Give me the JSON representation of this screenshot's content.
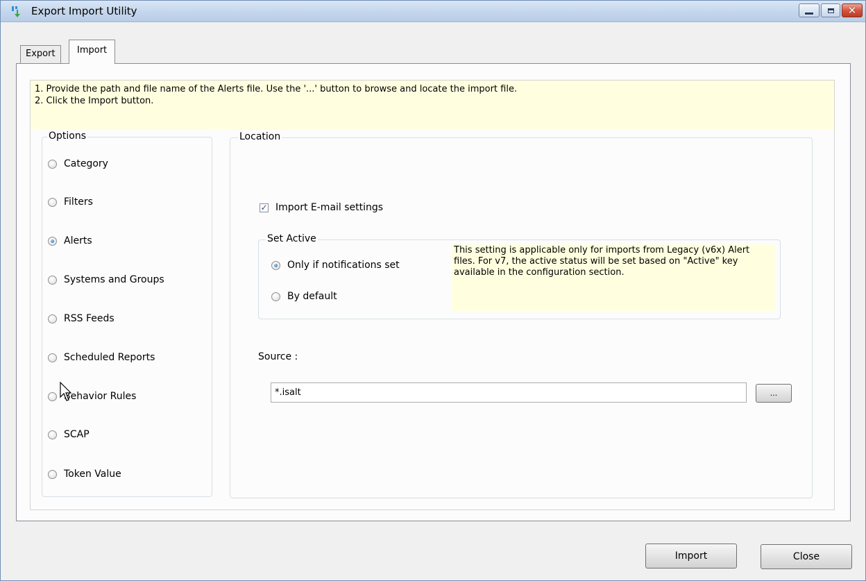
{
  "window": {
    "title": "Export Import Utility",
    "close_glyph": "✕"
  },
  "tabs": [
    {
      "label": "Export",
      "active": false
    },
    {
      "label": "Import",
      "active": true
    }
  ],
  "instructions": {
    "line1": "1. Provide the path and file name of the Alerts file. Use the '...' button to browse and locate the import file.",
    "line2": "2. Click the Import button."
  },
  "options": {
    "legend": "Options",
    "items": [
      {
        "label": "Category",
        "checked": false
      },
      {
        "label": "Filters",
        "checked": false
      },
      {
        "label": "Alerts",
        "checked": true
      },
      {
        "label": "Systems and Groups",
        "checked": false
      },
      {
        "label": "RSS Feeds",
        "checked": false
      },
      {
        "label": "Scheduled Reports",
        "checked": false
      },
      {
        "label": "Behavior Rules",
        "checked": false
      },
      {
        "label": "SCAP",
        "checked": false
      },
      {
        "label": "Token Value",
        "checked": false
      }
    ]
  },
  "location": {
    "legend": "Location",
    "import_email": {
      "label": "Import E-mail settings",
      "checked": true,
      "mark": "✓"
    },
    "set_active": {
      "legend": "Set Active",
      "options": [
        {
          "label": "Only if notifications set",
          "checked": true
        },
        {
          "label": "By default",
          "checked": false
        }
      ],
      "note": "This setting is applicable only for imports from Legacy (v6x) Alert files. For v7, the active status will be set based on \"Active\" key available in the configuration section."
    },
    "source": {
      "label": "Source :",
      "value": "*.isalt",
      "browse_label": "..."
    }
  },
  "buttons": {
    "import": "Import",
    "close": "Close"
  },
  "colors": {
    "info_background": "#ffffe0",
    "title_bar": "#c4d6ec",
    "close_button": "#c03a22"
  }
}
